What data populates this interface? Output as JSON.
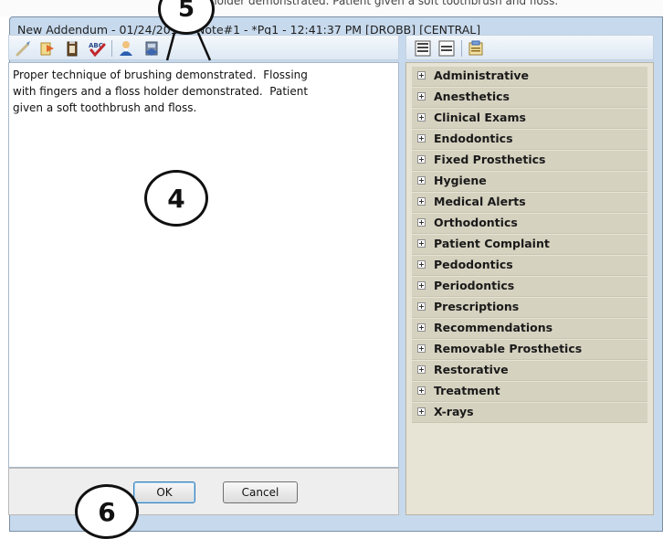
{
  "background_window": {
    "text": "holder demonstrated.  Patient given a soft toothbrush and floss."
  },
  "dialog": {
    "title": "New Addendum - 01/24/2012 - Note#1 - *Pg1 - 12:41:37 PM [DROBB] [CENTRAL]"
  },
  "toolbar": {
    "icons": [
      "brush-icon",
      "paste-icon",
      "clipboard-icon",
      "spellcheck-icon",
      "user-icon",
      "database-icon"
    ]
  },
  "right_toolbar": {
    "icons": [
      "expand-all-icon",
      "collapse-all-icon",
      "properties-icon"
    ]
  },
  "editor": {
    "text": "Proper technique of brushing demonstrated.  Flossing\nwith fingers and a floss holder demonstrated.  Patient\ngiven a soft toothbrush and floss."
  },
  "tree": {
    "items": [
      {
        "label": "Administrative"
      },
      {
        "label": "Anesthetics"
      },
      {
        "label": "Clinical Exams"
      },
      {
        "label": "Endodontics"
      },
      {
        "label": "Fixed Prosthetics"
      },
      {
        "label": "Hygiene"
      },
      {
        "label": "Medical Alerts"
      },
      {
        "label": "Orthodontics"
      },
      {
        "label": "Patient Complaint"
      },
      {
        "label": "Pedodontics"
      },
      {
        "label": "Periodontics"
      },
      {
        "label": "Prescriptions"
      },
      {
        "label": "Recommendations"
      },
      {
        "label": "Removable Prosthetics"
      },
      {
        "label": "Restorative"
      },
      {
        "label": "Treatment"
      },
      {
        "label": "X-rays"
      }
    ]
  },
  "buttons": {
    "ok": "OK",
    "cancel": "Cancel"
  },
  "callouts": {
    "four": "4",
    "five": "5",
    "six": "6"
  },
  "colors": {
    "dialog_bg": "#c7d9ec",
    "tree_bg": "#e7e4d6",
    "tree_item_bg": "#d6d2c0"
  }
}
